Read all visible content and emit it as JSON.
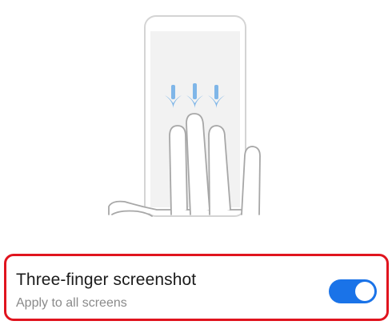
{
  "setting": {
    "title": "Three-finger screenshot",
    "subtitle": "Apply to all screens",
    "toggle_state": "on"
  },
  "illustration": {
    "icon": "three-finger-swipe-down-illustration"
  },
  "colors": {
    "accent": "#1a73e8",
    "highlight_border": "#e0141e",
    "arrow": "#7fb6e8",
    "phone_outline": "#d4d4d4",
    "phone_screen": "#f2f2f2",
    "hand_outline": "#a7a7a7"
  }
}
